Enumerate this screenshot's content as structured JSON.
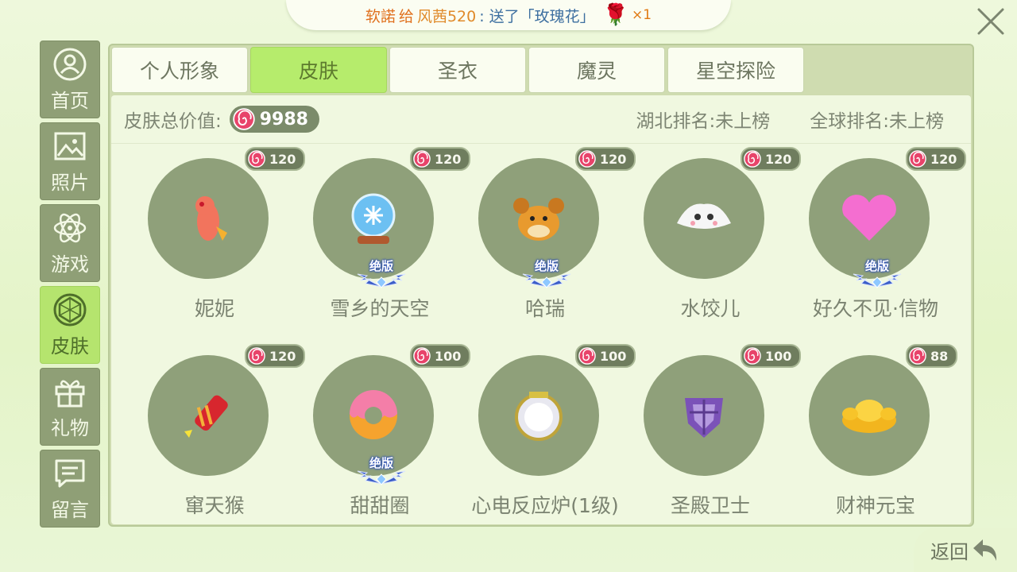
{
  "banner": {
    "sender": "软諾",
    "word_give": "给",
    "receiver": "风茜520",
    "action": ": 送了「玫瑰花」",
    "count": "×1"
  },
  "nav": [
    {
      "label": "首页",
      "icon": "person-icon"
    },
    {
      "label": "照片",
      "icon": "photo-icon"
    },
    {
      "label": "游戏",
      "icon": "atom-icon"
    },
    {
      "label": "皮肤",
      "icon": "gem-icon",
      "active": true
    },
    {
      "label": "礼物",
      "icon": "gift-icon"
    },
    {
      "label": "留言",
      "icon": "message-icon"
    }
  ],
  "tabs": [
    "个人形象",
    "皮肤",
    "圣衣",
    "魔灵",
    "星空探险"
  ],
  "active_tab": "皮肤",
  "stats": {
    "total_label": "皮肤总价值:",
    "total_value": "9988",
    "rank_hubei": "湖北排名:未上榜",
    "rank_global": "全球排名:未上榜"
  },
  "badge_text": "绝版",
  "items": [
    {
      "name": "妮妮",
      "price": "120",
      "limited": false
    },
    {
      "name": "雪乡的天空",
      "price": "120",
      "limited": true
    },
    {
      "name": "哈瑞",
      "price": "120",
      "limited": true
    },
    {
      "name": "水饺儿",
      "price": "120",
      "limited": false
    },
    {
      "name": "好久不见·信物",
      "price": "120",
      "limited": true
    },
    {
      "name": "窜天猴",
      "price": "120",
      "limited": false
    },
    {
      "name": "甜甜圈",
      "price": "100",
      "limited": true
    },
    {
      "name": "心电反应炉(1级)",
      "price": "100",
      "limited": false
    },
    {
      "name": "圣殿卫士",
      "price": "100",
      "limited": false
    },
    {
      "name": "财神元宝",
      "price": "88",
      "limited": false
    }
  ],
  "back_label": "返回",
  "colors": {
    "accent": "#b6ec6c",
    "nav_bg": "#8f9f76",
    "circle_bg": "#8fa07a",
    "candy": "#e8436a"
  }
}
